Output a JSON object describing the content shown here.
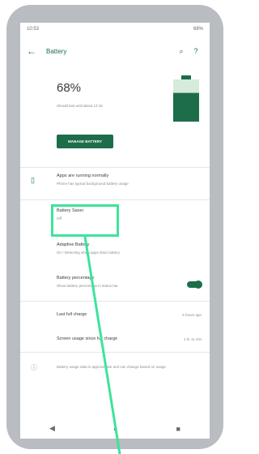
{
  "statusbar": {
    "time": "10:53",
    "battery": "68%"
  },
  "appbar": {
    "title": "Battery",
    "back_icon": "arrow-left-icon",
    "search_icon": "search-icon",
    "help_icon": "help-icon"
  },
  "hero": {
    "percentage": "68%",
    "until": "Should last until about 12:15",
    "battery_level": 0.68,
    "button_label": "MANAGE BATTERY"
  },
  "rows": {
    "apps": {
      "title": "Apps are running normally",
      "subtitle": "Phone has typical background battery usage"
    },
    "saver": {
      "title": "Battery Saver",
      "subtitle": "Off"
    },
    "adaptive": {
      "title": "Adaptive Battery",
      "subtitle": "On / Detecting when apps drain battery"
    },
    "percentage": {
      "title": "Battery percentage",
      "subtitle": "Show battery percentage in status bar",
      "enabled": true
    },
    "last_charge": {
      "title": "Last full charge",
      "value": "6 hours ago"
    },
    "screen_usage": {
      "title": "Screen usage since full charge",
      "value": "1 hr 11 min"
    },
    "footer": {
      "text": "Battery usage data is approximate and can change based on usage"
    }
  },
  "colors": {
    "accent": "#1e6d4a",
    "highlight": "#3ee39a"
  }
}
